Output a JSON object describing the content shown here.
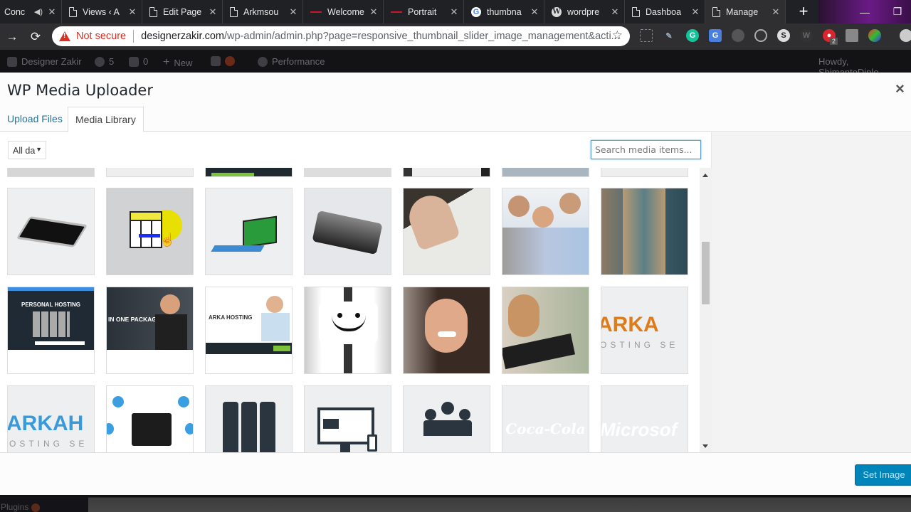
{
  "browser": {
    "tabs": [
      {
        "title": "Conc",
        "icon": "audio-playing",
        "active": false
      },
      {
        "title": "Views ‹ A",
        "icon": "document-icon",
        "active": false
      },
      {
        "title": "Edit Page",
        "icon": "document-icon",
        "active": false
      },
      {
        "title": "Arkmsou",
        "icon": "document-icon",
        "active": false
      },
      {
        "title": "Welcome",
        "icon": "red-flag-icon",
        "active": false
      },
      {
        "title": "Portrait",
        "icon": "red-flag-icon",
        "active": false
      },
      {
        "title": "thumbna",
        "icon": "google-icon",
        "active": false
      },
      {
        "title": "wordpre",
        "icon": "wordpress-icon",
        "active": false
      },
      {
        "title": "Dashboa",
        "icon": "document-icon",
        "active": false
      },
      {
        "title": "Manage",
        "icon": "document-icon",
        "active": true
      }
    ],
    "new_tab": "+",
    "window": {
      "minimize": "—",
      "restore": "❐"
    },
    "address": {
      "security": "Not secure",
      "host": "designerzakir.com",
      "path": "/wp-admin/admin.php?page=responsive_thumbnail_slider_image_management&acti..."
    },
    "extension_badge": "2"
  },
  "adminbar": {
    "site": "Designer Zakir",
    "updates": "5",
    "comments": "0",
    "new": "New",
    "performance": "Performance",
    "howdy": "Howdy, ShimantoDiplo"
  },
  "modal": {
    "title": "WP Media Uploader",
    "close": "×",
    "tabs": [
      {
        "label": "Upload Files",
        "active": false
      },
      {
        "label": "Media Library",
        "active": true
      }
    ],
    "filter": {
      "selected": "All da",
      "caret": "▼"
    },
    "search": {
      "placeholder": "Search media items...",
      "value": ""
    },
    "media": [
      {
        "desc": "iPad tablet",
        "row": 1
      },
      {
        "desc": "Rubik cube with cursor",
        "row": 1
      },
      {
        "desc": "Surface tablet green screen",
        "row": 1
      },
      {
        "desc": "Black laptop device",
        "row": 1
      },
      {
        "desc": "Hand on keyboard",
        "row": 1
      },
      {
        "desc": "Three people smiling at laptop",
        "row": 1
      },
      {
        "desc": "Woman using phone",
        "row": 1
      },
      {
        "desc": "Personal hosting website",
        "row": 2,
        "text": "PERSONAL HOSTING"
      },
      {
        "desc": "All in one package website",
        "row": 2,
        "text": "IN ONE PACKAGE"
      },
      {
        "desc": "Arka hosting website",
        "row": 2,
        "text": "ARKA HOSTING"
      },
      {
        "desc": "Smiley face card",
        "row": 2
      },
      {
        "desc": "Woman thumbs up",
        "row": 2
      },
      {
        "desc": "Woman handshake",
        "row": 2
      },
      {
        "desc": "Arka logo orange",
        "row": 2,
        "text": "ARKA",
        "subtext": "OSTING SE"
      },
      {
        "desc": "Arka logo blue",
        "row": 3,
        "text": "ARKAH",
        "subtext": "OSTING SE"
      },
      {
        "desc": "Server with icons",
        "row": 3
      },
      {
        "desc": "Server racks icon",
        "row": 3
      },
      {
        "desc": "Desktop and mobile icon",
        "row": 3
      },
      {
        "desc": "Business team icon",
        "row": 3
      },
      {
        "desc": "Coca-Cola logo white",
        "row": 3,
        "text": "Coca-Cola"
      },
      {
        "desc": "Microsoft logo white",
        "row": 3,
        "text": "Microsof"
      }
    ],
    "set_image": "Set Image"
  },
  "footer": {
    "plugins": "Plugins"
  },
  "colors": {
    "accent": "#0085ba",
    "link": "#21759b",
    "arka_orange": "#e07b1a",
    "arka_blue": "#3a9ad9"
  }
}
